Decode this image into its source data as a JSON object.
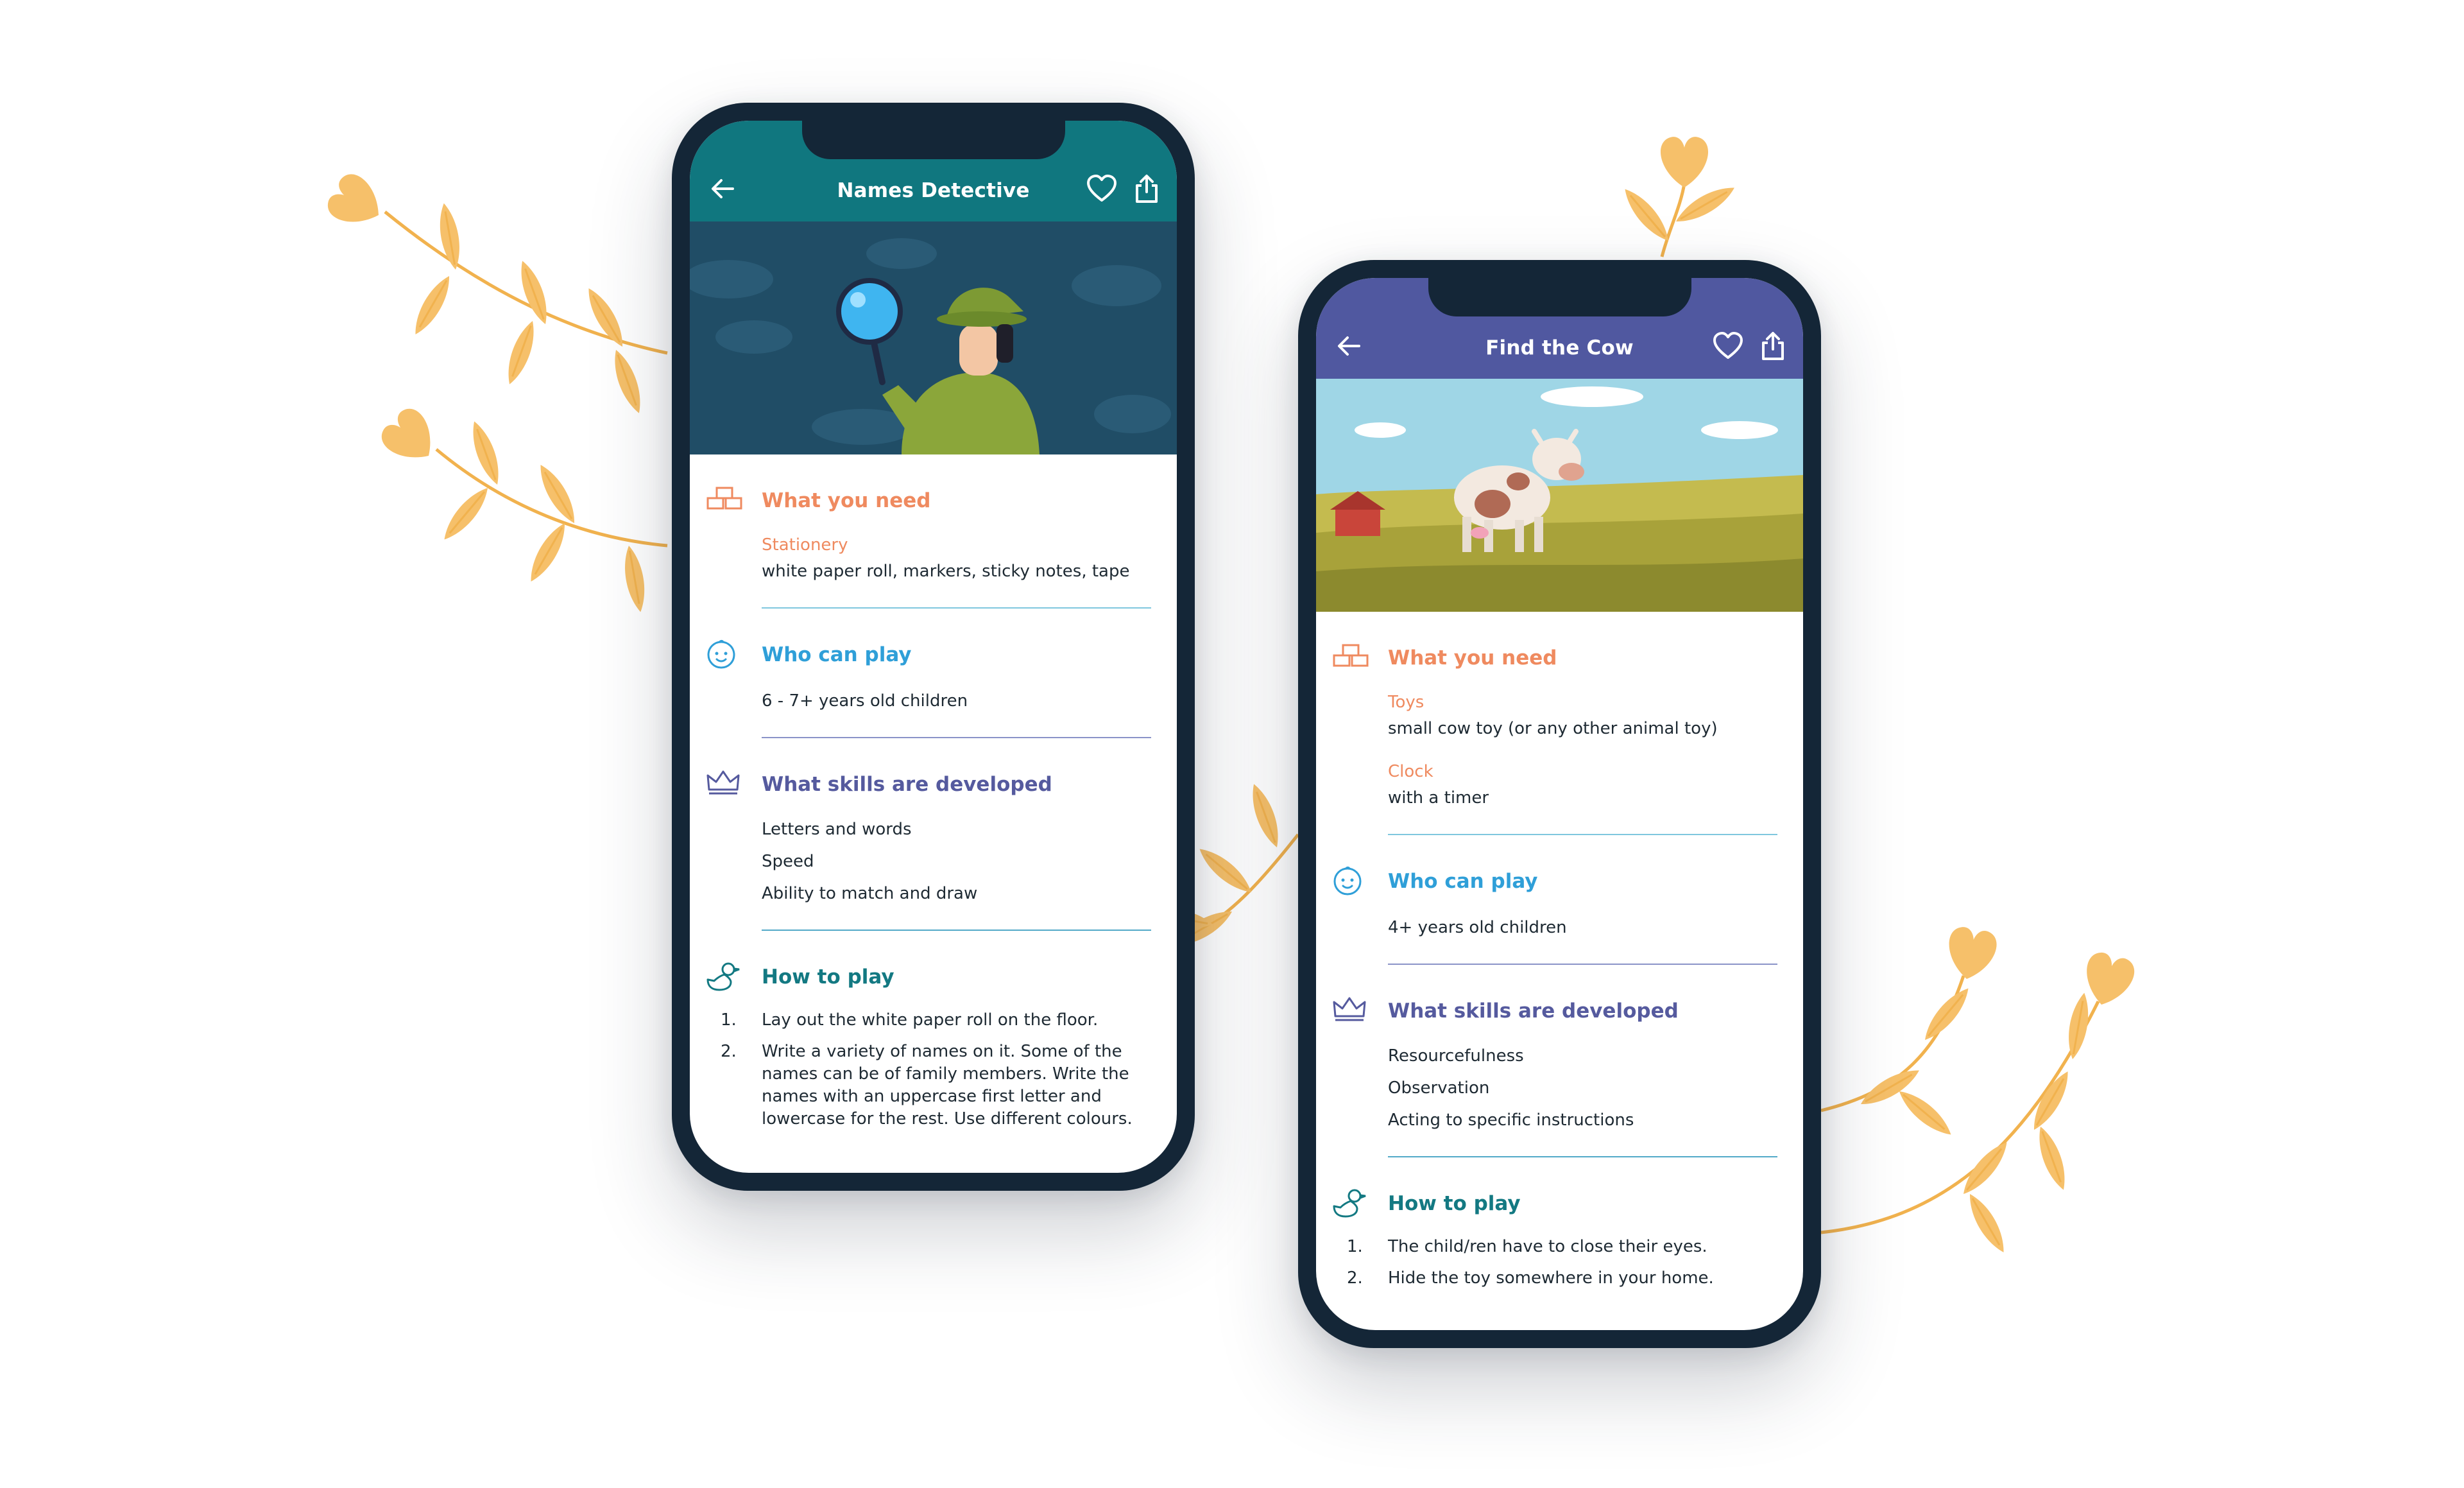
{
  "colors": {
    "leaf": "#f6c06a",
    "phone_frame": "#142637",
    "header_teal": "#10777f",
    "header_purple": "#5058a0",
    "orange": "#ef8a5f",
    "blue": "#2f9fd8",
    "purple": "#555a9e",
    "teal": "#137982"
  },
  "phones": [
    {
      "header": {
        "title": "Names Detective",
        "back_icon": "arrow-left-icon",
        "favorite_icon": "heart-icon",
        "share_icon": "share-icon"
      },
      "hero": "detective-with-magnifying-glass-illustration",
      "what_you_need": {
        "title": "What you need",
        "items": [
          {
            "label": "Stationery",
            "text": "white paper roll, markers, sticky notes, tape"
          }
        ]
      },
      "who_can_play": {
        "title": "Who can play",
        "text": "6 - 7+ years old children"
      },
      "skills": {
        "title": "What skills are developed",
        "items": [
          "Letters and words",
          "Speed",
          "Ability to match and draw"
        ]
      },
      "how_to_play": {
        "title": "How to play",
        "steps": [
          {
            "num": "1.",
            "text": "Lay out the white paper roll on the floor."
          },
          {
            "num": "2.",
            "text": "Write a variety of names on it. Some of the names can be of family members. Write the names with an uppercase first letter and lowercase for the rest. Use different colours."
          }
        ]
      }
    },
    {
      "header": {
        "title": "Find the Cow",
        "back_icon": "arrow-left-icon",
        "favorite_icon": "heart-icon",
        "share_icon": "share-icon"
      },
      "hero": "cow-in-field-illustration",
      "what_you_need": {
        "title": "What you need",
        "items": [
          {
            "label": "Toys",
            "text": "small cow toy (or any other animal toy)"
          },
          {
            "label": "Clock",
            "text": "with a timer"
          }
        ]
      },
      "who_can_play": {
        "title": "Who can play",
        "text": "4+ years old children"
      },
      "skills": {
        "title": "What skills are developed",
        "items": [
          "Resourcefulness",
          "Observation",
          "Acting to specific instructions"
        ]
      },
      "how_to_play": {
        "title": "How to play",
        "steps": [
          {
            "num": "1.",
            "text": "The child/ren have to close their eyes."
          },
          {
            "num": "2.",
            "text": "Hide the toy somewhere in your home."
          }
        ]
      }
    }
  ]
}
